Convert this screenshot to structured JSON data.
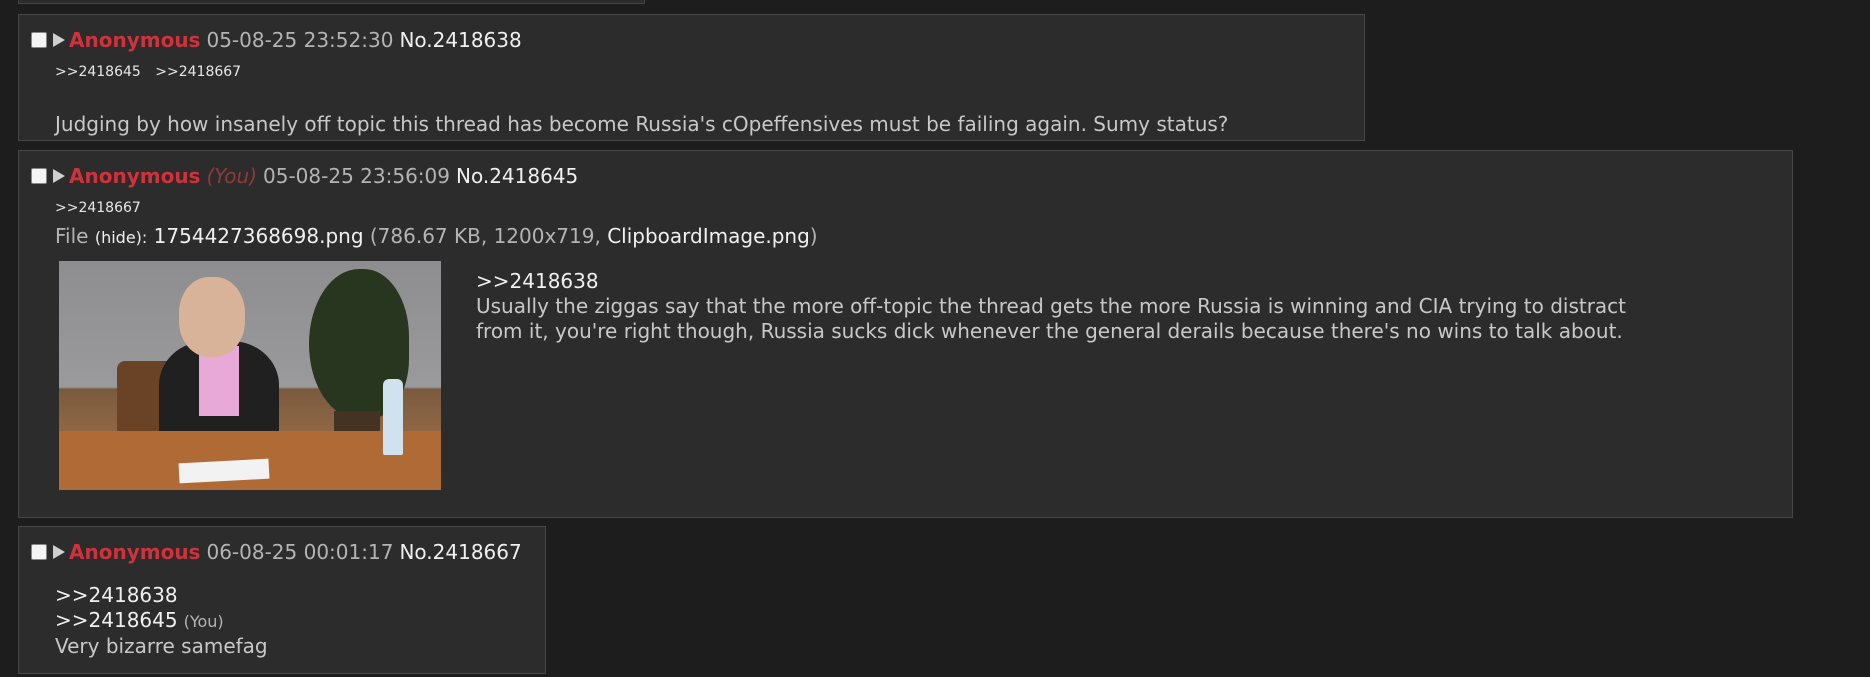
{
  "posts": [
    {
      "name": "Anonymous",
      "date": "05-08-25 23:52:30",
      "number": "No.2418638",
      "backlinks": [
        ">>2418645",
        ">>2418667"
      ],
      "comment": "Judging by how insanely off topic this thread has become Russia's cOpeffensives must be failing again. Sumy status?"
    },
    {
      "name": "Anonymous",
      "you_tag": "(You)",
      "date": "05-08-25 23:56:09",
      "number": "No.2418645",
      "backlinks": [
        ">>2418667"
      ],
      "file": {
        "label": "File",
        "hide_open": "(",
        "hide": "hide",
        "hide_close": "):",
        "filename": "1754427368698.png",
        "details_open": "(786.67 KB, 1200x719,",
        "original_name": "ClipboardImage.png",
        "details_close": ")"
      },
      "quote": ">>2418638",
      "comment_line1": "Usually the ziggas say that the more off-topic the thread gets the more Russia is winning and CIA trying to distract",
      "comment_line2": "from it, you're right though, Russia sucks dick whenever the general derails because there's no wins to talk about."
    },
    {
      "name": "Anonymous",
      "date": "06-08-25 00:01:17",
      "number": "No.2418667",
      "quote1": ">>2418638",
      "quote2": ">>2418645",
      "quote2_you": "(You)",
      "comment": "Very bizarre samefag"
    }
  ],
  "icons": {
    "checkbox": "checkbox-icon",
    "arrow": "post-menu-arrow-icon"
  },
  "colors": {
    "name": "#d0323b",
    "background": "#1d1d1d",
    "post_bg": "#2c2c2c"
  }
}
